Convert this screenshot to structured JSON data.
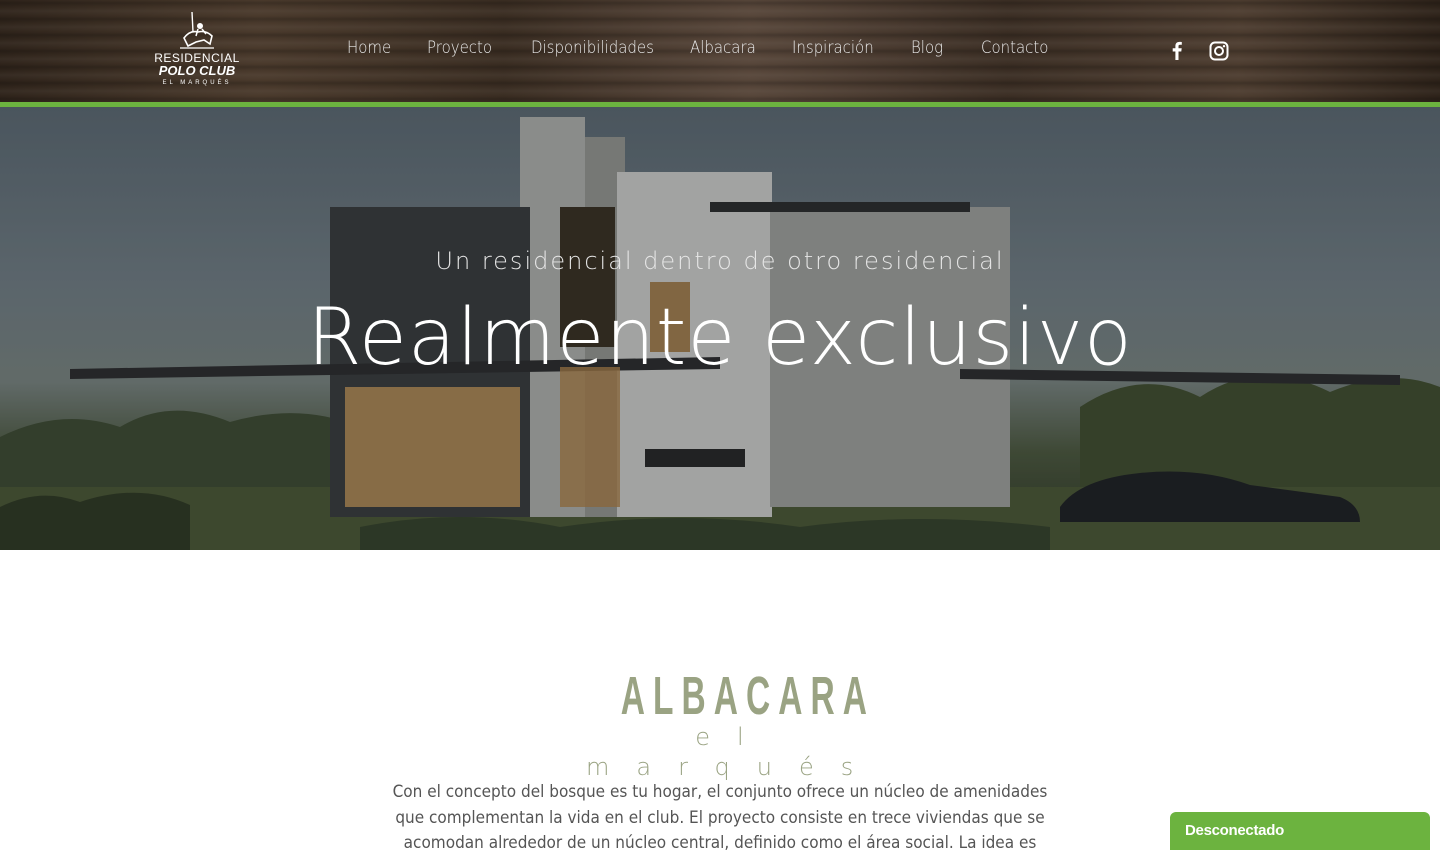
{
  "logo": {
    "line1": "RESIDENCIAL",
    "line2": "POLO CLUB",
    "line3": "EL MARQUÉS"
  },
  "nav": {
    "items": [
      "Home",
      "Proyecto",
      "Disponibilidades",
      "Albacara",
      "Inspiración",
      "Blog",
      "Contacto"
    ]
  },
  "social": {
    "icons": [
      "facebook-icon",
      "instagram-icon"
    ]
  },
  "hero": {
    "tagline": "Un residencial dentro de otro residencial",
    "title": "Realmente exclusivo"
  },
  "brand": {
    "name": "ALBACARA",
    "subtitle": "el marqués"
  },
  "intro": {
    "text": "Con el concepto del bosque es tu hogar, el conjunto ofrece un núcleo de amenidades que complementan la vida en el club. El proyecto consiste en trece viviendas que se acomodan alrededor de un núcleo central, definido como el área social. La idea es crear un espacio acogedor,"
  },
  "chat": {
    "status": "Desconectado"
  },
  "colors": {
    "accent": "#6cb33f",
    "brand_text": "#9aa383",
    "body_text": "#555555"
  }
}
